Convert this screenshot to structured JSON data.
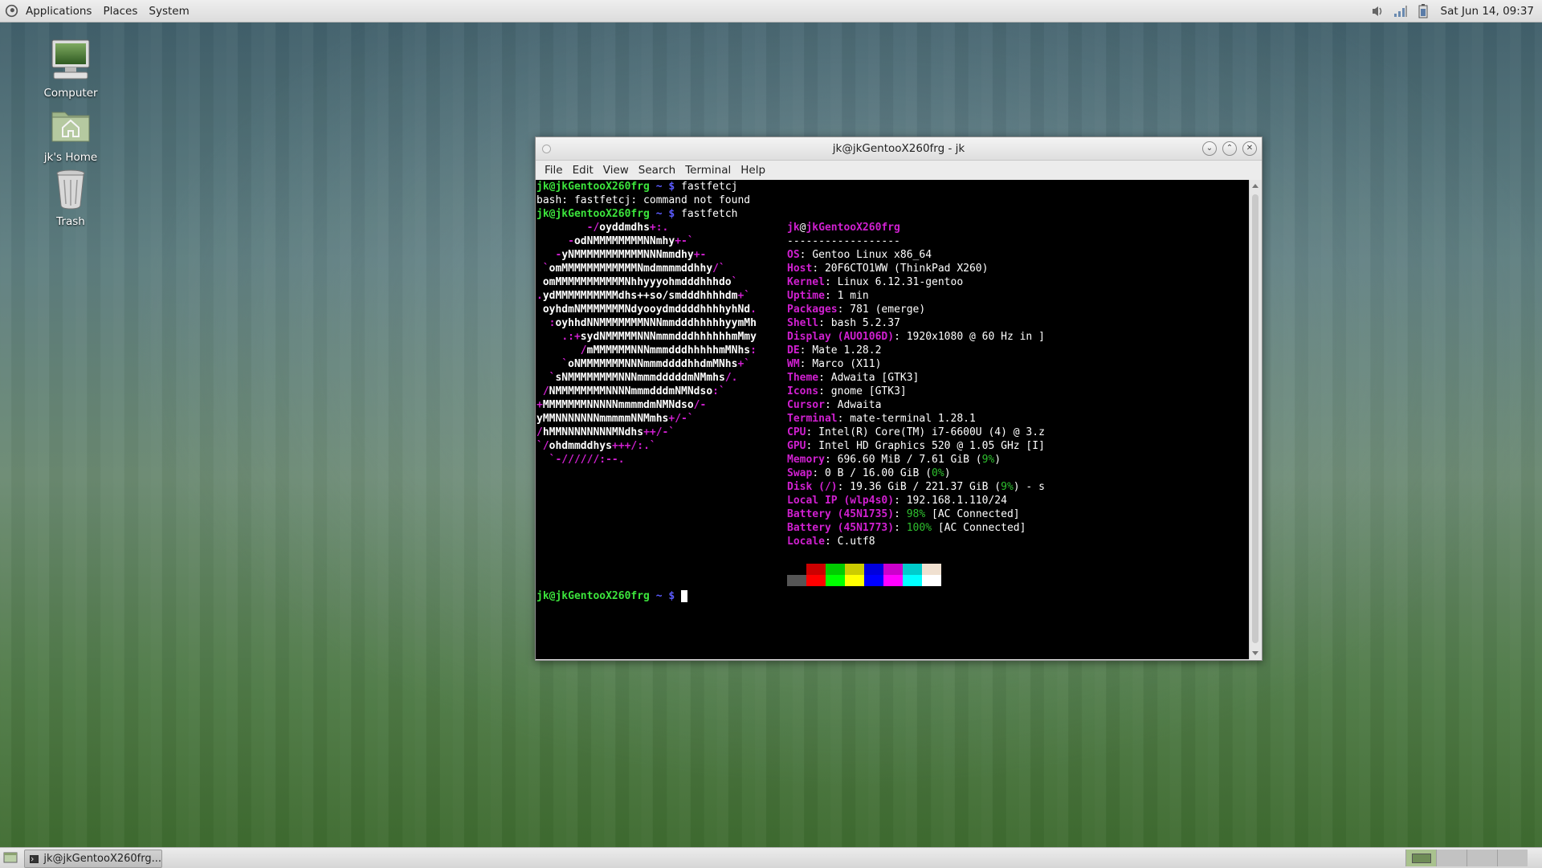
{
  "top_panel": {
    "menus": [
      "Applications",
      "Places",
      "System"
    ],
    "clock": "Sat Jun 14, 09:37",
    "tray_icons": [
      "volume-icon",
      "network-signal-icon",
      "battery-icon"
    ]
  },
  "desktop": {
    "icons": [
      {
        "label": "Computer",
        "icon": "computer-icon"
      },
      {
        "label": "jk's Home",
        "icon": "home-folder-icon"
      },
      {
        "label": "Trash",
        "icon": "trash-icon"
      }
    ]
  },
  "window": {
    "title": "jk@jkGentooX260frg - jk",
    "menu": [
      "File",
      "Edit",
      "View",
      "Search",
      "Terminal",
      "Help"
    ]
  },
  "terminal": {
    "prompt_user": "jk@jkGentooX260frg",
    "prompt_dir": "~",
    "prompt_sym": "$",
    "cmd1": "fastfetcj",
    "err1": "bash: fastfetcj: command not found",
    "cmd2": "fastfetch",
    "logo": [
      "        -/oyddmdhs+:.",
      "     -odNMMMMMMMMNNmhy+-`",
      "   -yNMMMMMMMMMMMNNNmmdhy+-",
      " `omMMMMMMMMMMMMNmdmmmmddhhy/`",
      " omMMMMMMMMMMMNhhyyyohmdddhhhdo`",
      ".ydMMMMMMMMMMdhs++so/smdddhhhhdm+`",
      " oyhdmNMMMMMMMNdyooydmddddhhhhyhNd.",
      "  :oyhhdNNMMMMMMMNNNmmdddhhhhhyymMh",
      "    .:+sydNMMMMMNNNmmmdddhhhhhhmMmy",
      "       /mMMMMMMNNNmmmdddhhhhhmMNhs:",
      "    `oNMMMMMMMNNNmmmddddhhdmMNhs+`",
      "  `sNMMMMMMMMNNNmmmdddddmNMmhs/.",
      " /NMMMMMMMMNNNNmmmdddmNMNdso:`",
      "+MMMMMMMNNNNNmmmmdmNMNdso/-",
      "yMMNNNNNNNmmmmmNNMmhs+/-`",
      "/hMMNNNNNNNNMNdhs++/-`",
      "`/ohdmmddhys+++/:.`",
      "  `-//////:--."
    ],
    "info_user": "jk",
    "info_at": "@",
    "info_host": "jkGentooX260frg",
    "separator": "------------------",
    "info": [
      {
        "key": "OS",
        "value": "Gentoo Linux x86_64"
      },
      {
        "key": "Host",
        "value": "20F6CTO1WW (ThinkPad X260)"
      },
      {
        "key": "Kernel",
        "value": "Linux 6.12.31-gentoo"
      },
      {
        "key": "Uptime",
        "value": "1 min"
      },
      {
        "key": "Packages",
        "value": "781 (emerge)"
      },
      {
        "key": "Shell",
        "value": "bash 5.2.37"
      },
      {
        "key": "Display (AUO106D)",
        "value": "1920x1080 @ 60 Hz in ]"
      },
      {
        "key": "DE",
        "value": "Mate 1.28.2"
      },
      {
        "key": "WM",
        "value": "Marco (X11)"
      },
      {
        "key": "Theme",
        "value": "Adwaita [GTK3]"
      },
      {
        "key": "Icons",
        "value": "gnome [GTK3]"
      },
      {
        "key": "Cursor",
        "value": "Adwaita"
      },
      {
        "key": "Terminal",
        "value": "mate-terminal 1.28.1"
      },
      {
        "key": "CPU",
        "value": "Intel(R) Core(TM) i7-6600U (4) @ 3.z"
      },
      {
        "key": "GPU",
        "value": "Intel HD Graphics 520 @ 1.05 GHz [I]"
      },
      {
        "key": "Memory",
        "value": "696.60 MiB / 7.61 GiB (",
        "pct": "9%",
        "tail": ")"
      },
      {
        "key": "Swap",
        "value": "0 B / 16.00 GiB (",
        "pct": "0%",
        "tail": ")"
      },
      {
        "key": "Disk (/)",
        "value": "19.36 GiB / 221.37 GiB (",
        "pct": "9%",
        "tail": ") - s"
      },
      {
        "key": "Local IP (wlp4s0)",
        "value": "192.168.1.110/24"
      },
      {
        "key": "Battery (45N1735)",
        "value": "",
        "pct": "98%",
        "tail": " [AC Connected]"
      },
      {
        "key": "Battery (45N1773)",
        "value": "",
        "pct": "100%",
        "tail": " [AC Connected]"
      },
      {
        "key": "Locale",
        "value": "C.utf8"
      }
    ],
    "palette_top": [
      "#000000",
      "#cc0000",
      "#00cc00",
      "#cccc00",
      "#0000dd",
      "#cc00cc",
      "#00cccc",
      "#f0e0d0"
    ],
    "palette_bottom": [
      "#555555",
      "#ff0000",
      "#00ff00",
      "#ffff00",
      "#0000ff",
      "#ff00ff",
      "#00ffff",
      "#ffffff"
    ]
  },
  "bottom_panel": {
    "task_label": "jk@jkGentooX260frg..."
  },
  "colors": {
    "prompt_green": "#3ce43c",
    "prompt_blue": "#5b5bff",
    "fastfetch_magenta": "#d020d0",
    "percent_green": "#2ec02e"
  }
}
